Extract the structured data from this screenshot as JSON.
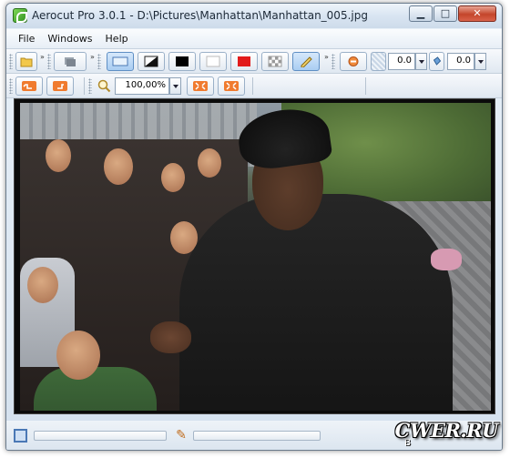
{
  "window": {
    "title": "Aerocut Pro 3.0.1 - D:\\Pictures\\Manhattan\\Manhattan_005.jpg"
  },
  "menu": {
    "items": [
      {
        "label": "File"
      },
      {
        "label": "Windows"
      },
      {
        "label": "Help"
      }
    ]
  },
  "toolbar1": {
    "spin1_value": "0.0",
    "spin2_value": "0.0"
  },
  "toolbar2": {
    "zoom_value": "100,00%"
  },
  "colors": {
    "accent_red": "#e21b1b",
    "accent_blue": "#5f8fc4",
    "brand_orange": "#e8661f"
  },
  "watermark": {
    "text": "CWER.RU",
    "prefix": "B"
  }
}
